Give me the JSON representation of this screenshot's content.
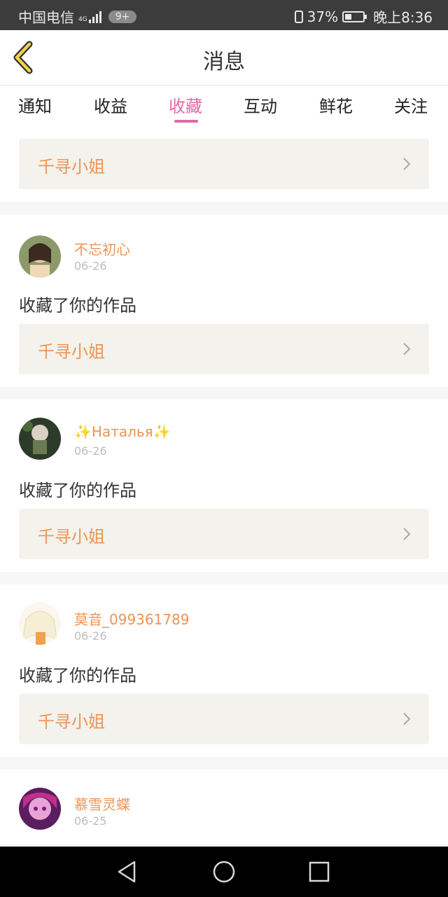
{
  "status_bar": {
    "carrier": "中国电信",
    "network": "4G",
    "notification_badge": "9+",
    "battery": "37%",
    "battery_level": 0.37,
    "time": "晚上8:36"
  },
  "header": {
    "title": "消息"
  },
  "tabs": [
    {
      "label": "通知"
    },
    {
      "label": "收益"
    },
    {
      "label": "收藏",
      "active": true
    },
    {
      "label": "互动"
    },
    {
      "label": "鲜花"
    },
    {
      "label": "关注"
    }
  ],
  "first_card": {
    "work_title": "千寻小姐"
  },
  "messages": [
    {
      "username": "不忘初心",
      "date": "06-26",
      "action": "收藏了你的作品",
      "work_title": "千寻小姐"
    },
    {
      "username": "✨Наталья✨",
      "date": "06-26",
      "action": "收藏了你的作品",
      "work_title": "千寻小姐"
    },
    {
      "username": "莫音_099361789",
      "date": "06-26",
      "action": "收藏了你的作品",
      "work_title": "千寻小姐"
    },
    {
      "username": "慕雪灵蝶",
      "date": "06-25"
    }
  ],
  "colors": {
    "accent": "#e06aa6",
    "username": "#ee9455",
    "work_title": "#ee9455"
  },
  "icons": [
    "back-chevron-icon",
    "chevron-right-icon",
    "nav-back-icon",
    "nav-home-icon",
    "nav-recents-icon"
  ]
}
